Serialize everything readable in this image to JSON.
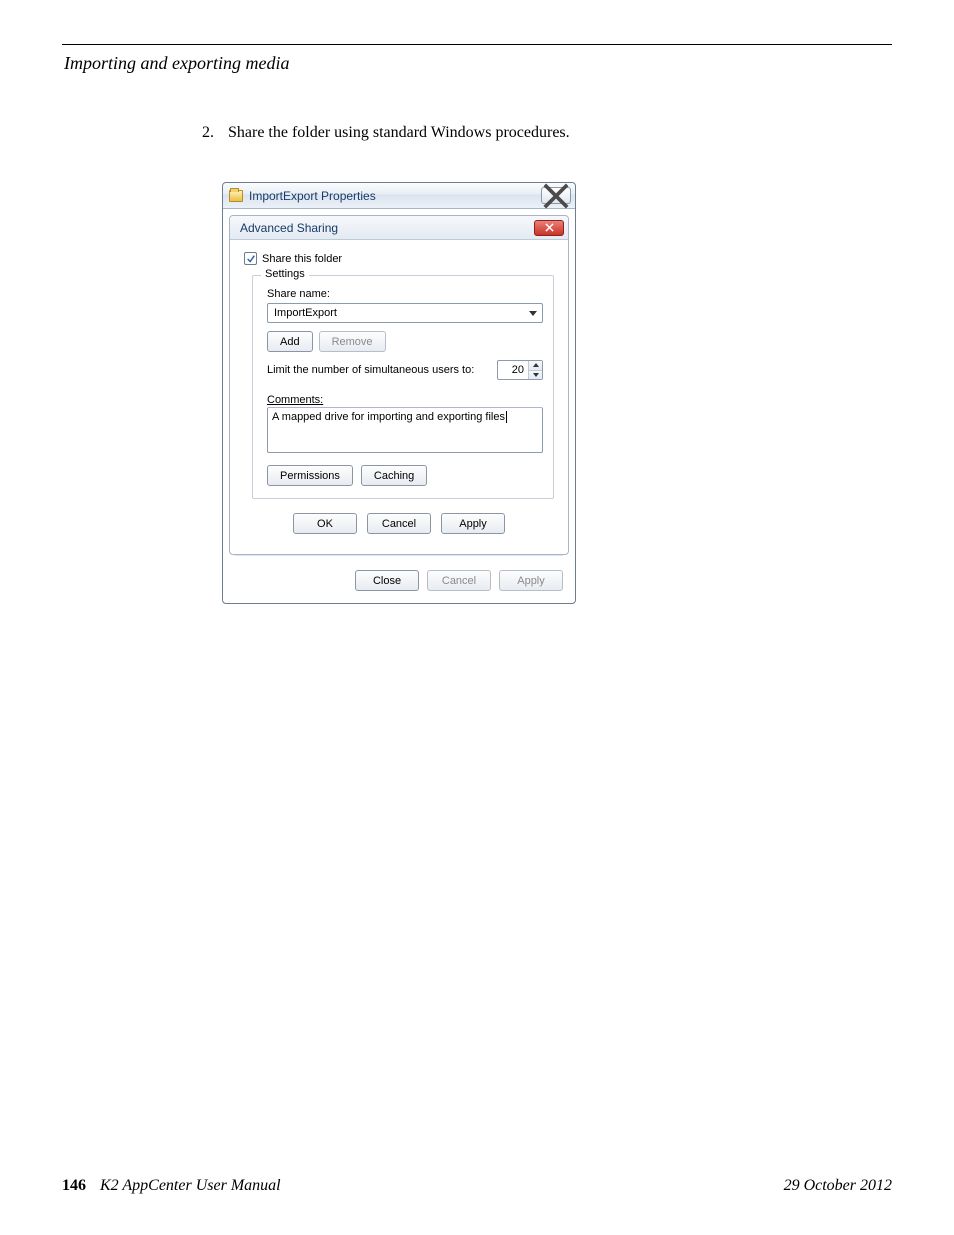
{
  "page": {
    "section_header": "Importing and exporting media",
    "step_number": "2.",
    "step_text": "Share the folder using standard Windows procedures.",
    "page_number": "146",
    "manual_title": "K2 AppCenter User Manual",
    "date": "29 October 2012"
  },
  "dialog": {
    "outer_title": "ImportExport Properties",
    "inner_title": "Advanced Sharing",
    "share_checkbox_label": "Share this folder",
    "settings_legend": "Settings",
    "share_name_label": "Share name:",
    "share_name_value": "ImportExport",
    "add_btn": "Add",
    "remove_btn": "Remove",
    "limit_label": "Limit the number of simultaneous users to:",
    "limit_value": "20",
    "comments_label": "Comments:",
    "comments_value": "A mapped drive for importing and exporting files",
    "permissions_btn": "Permissions",
    "caching_btn": "Caching",
    "ok_btn": "OK",
    "cancel_btn": "Cancel",
    "apply_btn": "Apply",
    "close_btn": "Close",
    "outer_cancel_btn": "Cancel",
    "outer_apply_btn": "Apply"
  }
}
